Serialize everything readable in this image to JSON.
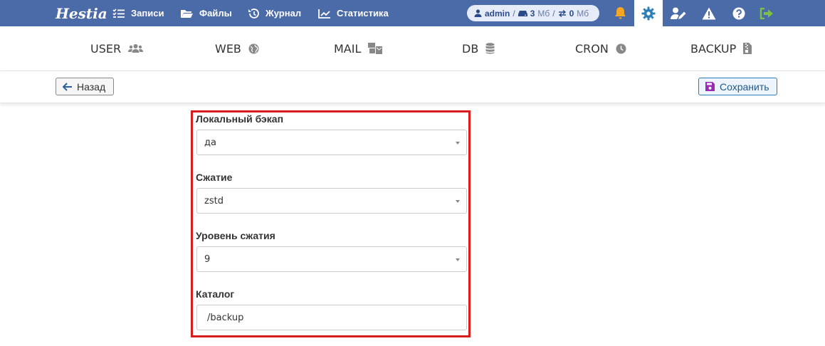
{
  "topbar": {
    "logo_text": "Hestia",
    "menu": [
      {
        "label": "Записи",
        "icon": "list-check-icon"
      },
      {
        "label": "Файлы",
        "icon": "folder-open-icon"
      },
      {
        "label": "Журнал",
        "icon": "history-icon"
      },
      {
        "label": "Статистика",
        "icon": "chart-line-icon"
      }
    ],
    "user_pill": {
      "user": "admin",
      "disk_value": "3",
      "disk_unit": "Мб",
      "bandwidth_value": "0",
      "bandwidth_unit": "Мб"
    },
    "icons": [
      "bell-icon",
      "gear-icon",
      "user-edit-icon",
      "warning-icon",
      "help-icon",
      "logout-icon"
    ],
    "colors": {
      "bar": "#4b6aa8",
      "bell": "#f5a623",
      "gear": "#2c7fb8",
      "logout": "#7bc043"
    }
  },
  "tabs": [
    {
      "label": "USER",
      "icon": "users-icon"
    },
    {
      "label": "WEB",
      "icon": "globe-icon"
    },
    {
      "label": "MAIL",
      "icon": "mail-bulk-icon"
    },
    {
      "label": "DB",
      "icon": "database-icon"
    },
    {
      "label": "CRON",
      "icon": "clock-icon"
    },
    {
      "label": "BACKUP",
      "icon": "file-archive-icon"
    }
  ],
  "toolbar": {
    "back_label": "Назад",
    "save_label": "Сохранить"
  },
  "form": {
    "local_backup": {
      "label": "Локальный бэкап",
      "value": "да"
    },
    "compression": {
      "label": "Сжатие",
      "value": "zstd"
    },
    "compression_level": {
      "label": "Уровень сжатия",
      "value": "9"
    },
    "directory": {
      "label": "Каталог",
      "value": "/backup"
    }
  }
}
